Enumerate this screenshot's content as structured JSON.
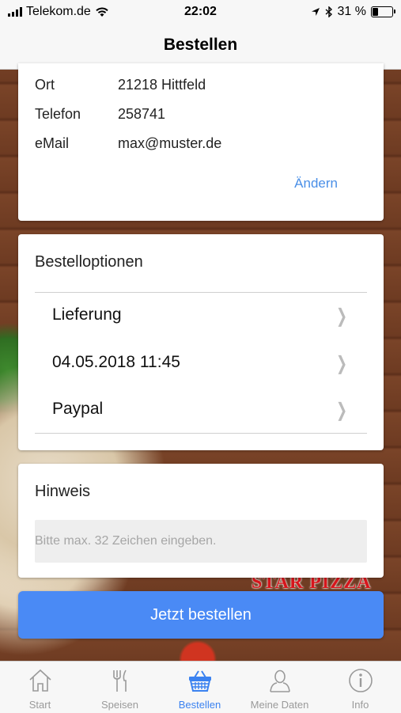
{
  "status": {
    "carrier": "Telekom.de",
    "time": "22:02",
    "battery": "31 %",
    "battery_level": 0.31
  },
  "navbar": {
    "title": "Bestellen"
  },
  "address": {
    "rows": [
      {
        "key": "Ort",
        "value": "21218 Hittfeld"
      },
      {
        "key": "Telefon",
        "value": "258741"
      },
      {
        "key": "eMail",
        "value": "max@muster.de"
      }
    ],
    "change_label": "Ändern"
  },
  "options": {
    "title": "Bestelloptionen",
    "items": [
      {
        "label": "Lieferung"
      },
      {
        "label": "04.05.2018 11:45"
      },
      {
        "label": "Paypal"
      }
    ]
  },
  "note": {
    "title": "Hinweis",
    "placeholder": "Bitte max. 32 Zeichen eingeben."
  },
  "order_button": {
    "label": "Jetzt bestellen"
  },
  "background": {
    "brand": "STAR PIZZA"
  },
  "tabs": [
    {
      "label": "Start",
      "icon": "home-icon"
    },
    {
      "label": "Speisen",
      "icon": "cutlery-icon"
    },
    {
      "label": "Bestellen",
      "icon": "basket-icon",
      "active": true
    },
    {
      "label": "Meine Daten",
      "icon": "user-icon"
    },
    {
      "label": "Info",
      "icon": "info-icon"
    }
  ],
  "colors": {
    "accent": "#4a8af5",
    "link": "#4a8fe7",
    "active_tab": "#3b82f0"
  }
}
